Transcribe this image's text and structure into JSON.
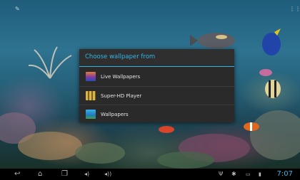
{
  "dialog": {
    "title": "Choose wallpaper from",
    "items": [
      {
        "label": "Live Wallpapers",
        "icon": "live-wallpapers-icon"
      },
      {
        "label": "Super-HD Player",
        "icon": "video-player-icon"
      },
      {
        "label": "Wallpapers",
        "icon": "gallery-icon"
      }
    ]
  },
  "statusbar": {
    "clock": "7:07"
  },
  "navbar": [
    "back-icon",
    "home-icon",
    "recent-apps-icon",
    "volume-down-icon",
    "volume-up-icon"
  ],
  "colors": {
    "accent": "#33b5e5",
    "dialog_bg": "#2a2a2a"
  }
}
